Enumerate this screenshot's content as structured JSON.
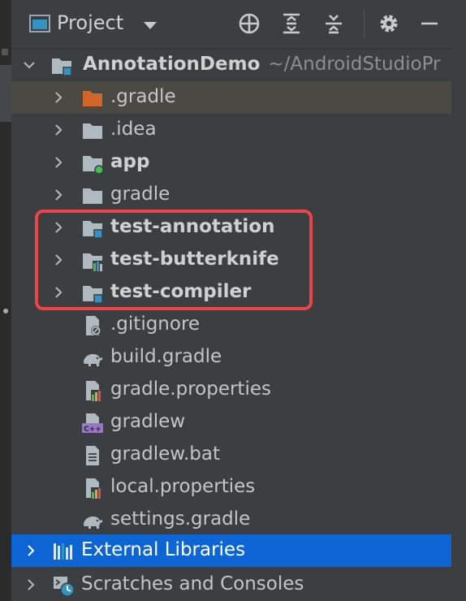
{
  "header": {
    "title": "Project"
  },
  "tree": {
    "root": {
      "label": "AnnotationDemo",
      "hint": "~/AndroidStudioPr"
    },
    "items": [
      {
        "label": ".gradle"
      },
      {
        "label": ".idea"
      },
      {
        "label": "app"
      },
      {
        "label": "gradle"
      },
      {
        "label": "test-annotation"
      },
      {
        "label": "test-butterknife"
      },
      {
        "label": "test-compiler"
      },
      {
        "label": ".gitignore"
      },
      {
        "label": "build.gradle"
      },
      {
        "label": "gradle.properties"
      },
      {
        "label": "gradlew"
      },
      {
        "label": "gradlew.bat"
      },
      {
        "label": "local.properties"
      },
      {
        "label": "settings.gradle"
      }
    ],
    "external": {
      "label": "External Libraries"
    },
    "scratches": {
      "label": "Scratches and Consoles"
    }
  },
  "colors": {
    "background": "#3c3f41",
    "selection": "#0d65d3",
    "highlight_box": "#ee4447",
    "module_badge": "#3592c4",
    "app_badge": "#3fc152"
  }
}
